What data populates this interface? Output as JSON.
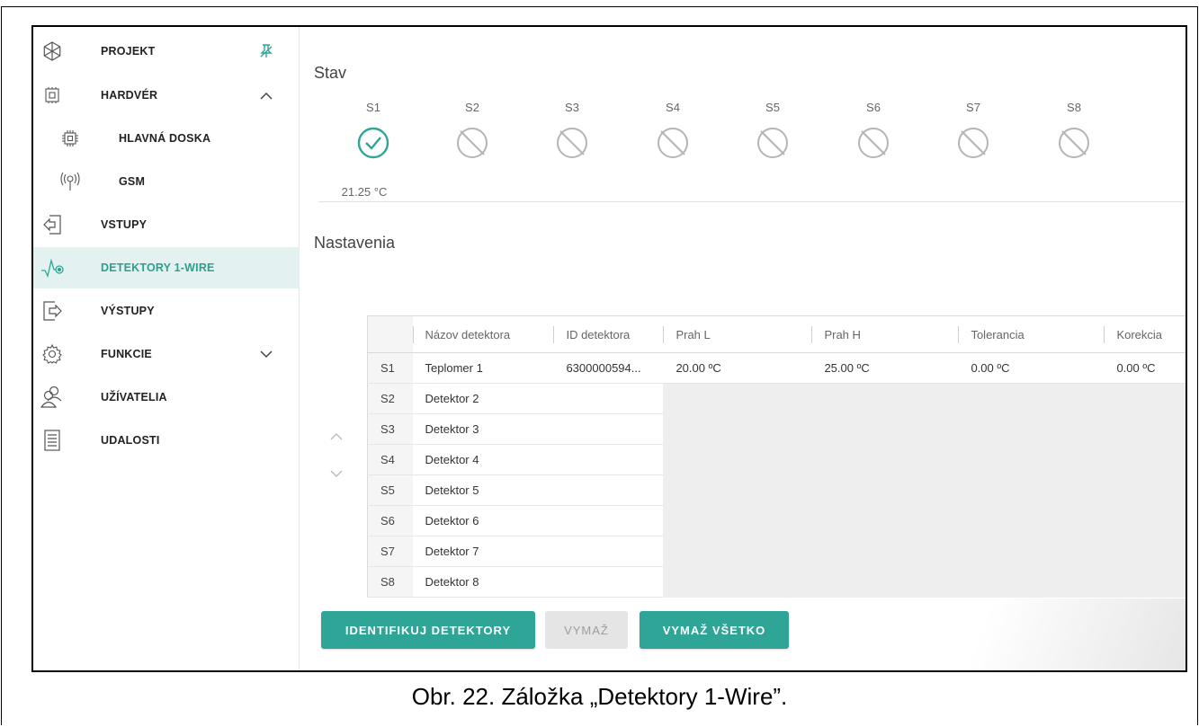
{
  "sidebar": {
    "items": [
      {
        "label": "PROJEKT",
        "icon": "project-icon",
        "right_icon": "pin-icon"
      },
      {
        "label": "HARDVÉR",
        "icon": "hardware-icon",
        "right_icon": "chevron-up-icon"
      },
      {
        "label": "HLAVNÁ DOSKA",
        "icon": "mainboard-icon"
      },
      {
        "label": "GSM",
        "icon": "gsm-antenna-icon"
      },
      {
        "label": "VSTUPY",
        "icon": "inputs-icon"
      },
      {
        "label": "DETEKTORY 1-WIRE",
        "icon": "detectors-1wire-icon",
        "active": true
      },
      {
        "label": "VÝSTUPY",
        "icon": "outputs-icon"
      },
      {
        "label": "FUNKCIE",
        "icon": "functions-gear-icon",
        "right_icon": "chevron-down-icon"
      },
      {
        "label": "UŽÍVATELIA",
        "icon": "users-icon"
      },
      {
        "label": "UDALOSTI",
        "icon": "events-list-icon"
      }
    ]
  },
  "status": {
    "title": "Stav",
    "sensors": [
      {
        "label": "S1",
        "state": "ok",
        "icon": "check-circle-icon"
      },
      {
        "label": "S2",
        "state": "none",
        "icon": "not-available-icon"
      },
      {
        "label": "S3",
        "state": "none",
        "icon": "not-available-icon"
      },
      {
        "label": "S4",
        "state": "none",
        "icon": "not-available-icon"
      },
      {
        "label": "S5",
        "state": "none",
        "icon": "not-available-icon"
      },
      {
        "label": "S6",
        "state": "none",
        "icon": "not-available-icon"
      },
      {
        "label": "S7",
        "state": "none",
        "icon": "not-available-icon"
      },
      {
        "label": "S8",
        "state": "none",
        "icon": "not-available-icon"
      }
    ],
    "s1_temperature": "21.25 °C"
  },
  "settings": {
    "title": "Nastavenia",
    "columns": [
      "",
      "Názov detektora",
      "ID detektora",
      "Prah L",
      "Prah H",
      "Tolerancia",
      "Korekcia"
    ],
    "rows": [
      {
        "id": "S1",
        "name": "Teplomer 1",
        "detector_id": "6300000594...",
        "prah_l": "20.00 ºC",
        "prah_h": "25.00 ºC",
        "tolerancia": "0.00 ºC",
        "korekcia": "0.00 ºC"
      },
      {
        "id": "S2",
        "name": "Detektor 2"
      },
      {
        "id": "S3",
        "name": "Detektor 3"
      },
      {
        "id": "S4",
        "name": "Detektor 4"
      },
      {
        "id": "S5",
        "name": "Detektor 5"
      },
      {
        "id": "S6",
        "name": "Detektor 6"
      },
      {
        "id": "S7",
        "name": "Detektor 7"
      },
      {
        "id": "S8",
        "name": "Detektor 8"
      }
    ]
  },
  "buttons": {
    "identify": "IDENTIFIKUJ DETEKTORY",
    "delete": "VYMAŽ",
    "delete_all": "VYMAŽ VŠETKO"
  },
  "caption": "Obr. 22. Záložka „Detektory 1-Wire”.",
  "colors": {
    "accent": "#2ea597",
    "active_bg": "#e3f2f0",
    "disabled_button": "#e5e5e5"
  }
}
